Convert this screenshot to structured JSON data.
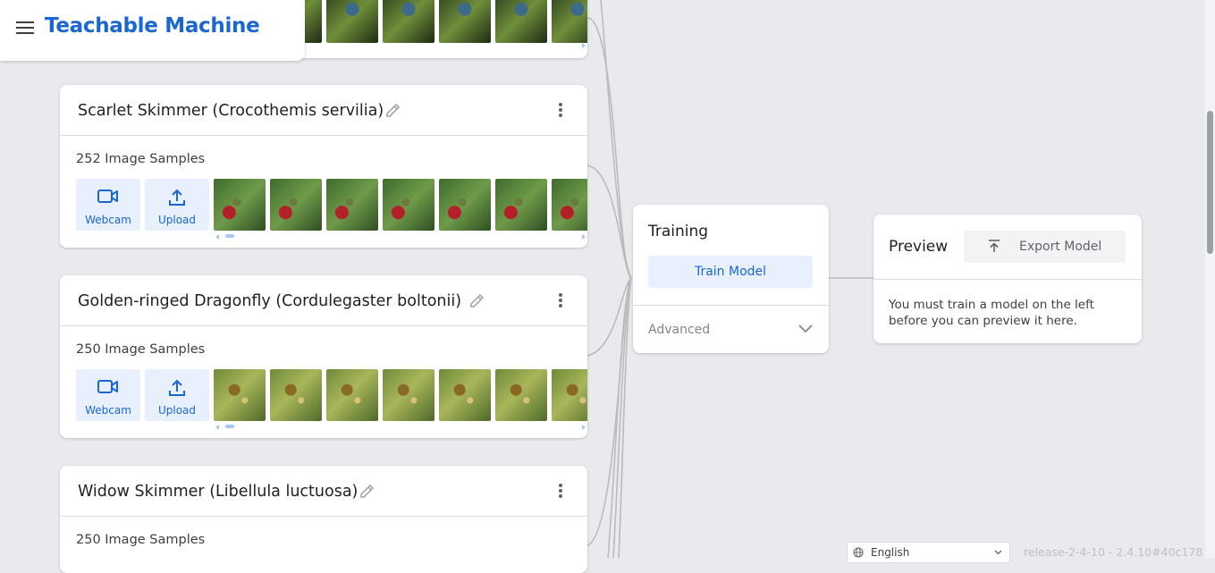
{
  "app": {
    "title": "Teachable Machine"
  },
  "classes": [
    {
      "name": "Scarlet Skimmer (Crocothemis servilia)",
      "samples": "252 Image Samples"
    },
    {
      "name": "Golden-ringed Dragonfly (Cordulegaster boltonii)",
      "samples": "250 Image Samples"
    },
    {
      "name": "Widow Skimmer (Libellula luctuosa)",
      "samples": "250 Image Samples"
    }
  ],
  "sample_buttons": {
    "webcam": "Webcam",
    "upload": "Upload"
  },
  "training": {
    "title": "Training",
    "train_button": "Train Model",
    "advanced": "Advanced"
  },
  "preview": {
    "title": "Preview",
    "export_button": "Export Model",
    "message": "You must train a model on the left before you can preview it here."
  },
  "footer": {
    "language": "English",
    "release": "release-2-4-10 - 2.4.10#40c178"
  },
  "colors": {
    "accent": "#1967d2",
    "accent_bg": "#e8f0fe",
    "page_bg": "#e8eaed"
  },
  "icons": [
    "menu-icon",
    "edit-icon",
    "more-vert-icon",
    "webcam-icon",
    "upload-icon",
    "chevron-down-icon",
    "export-icon",
    "globe-icon"
  ]
}
